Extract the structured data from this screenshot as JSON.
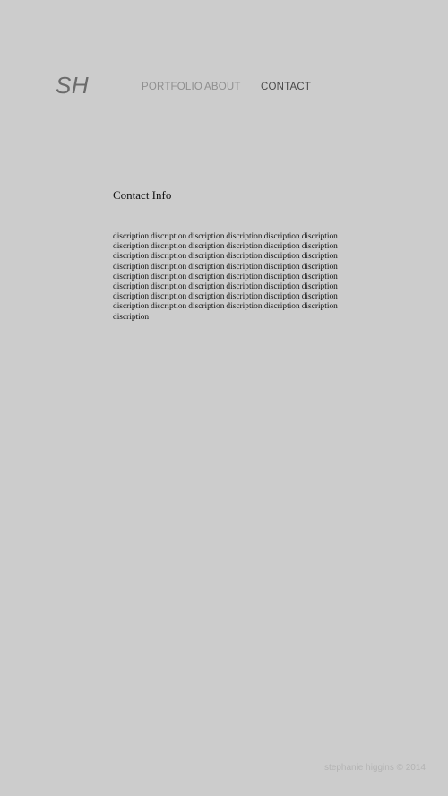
{
  "logo": {
    "text": "SH"
  },
  "nav": {
    "items": [
      {
        "label": "PORTFOLIO",
        "active": false
      },
      {
        "label": "ABOUT",
        "active": false
      },
      {
        "label": "CONTACT",
        "active": true
      }
    ]
  },
  "content": {
    "title": "Contact Info",
    "description": "discription discription discription discription discription discription discription discription discription discription discription discription discription discription discription discription discription discription discription discription discription discription discription discription discription discription discription discription discription discription discription discription discription discription discription discription discription discription discription discription discription discription discription discription discription discription discription discription discription"
  },
  "footer": {
    "text": "stephanie higgins © 2014"
  },
  "colors": {
    "background": "#cccccc",
    "logo": "#6b6b6b",
    "nav_inactive": "#8f8f8f",
    "nav_active": "#4a4a4a",
    "body_text": "#111111",
    "footer": "#b3b3b3"
  }
}
